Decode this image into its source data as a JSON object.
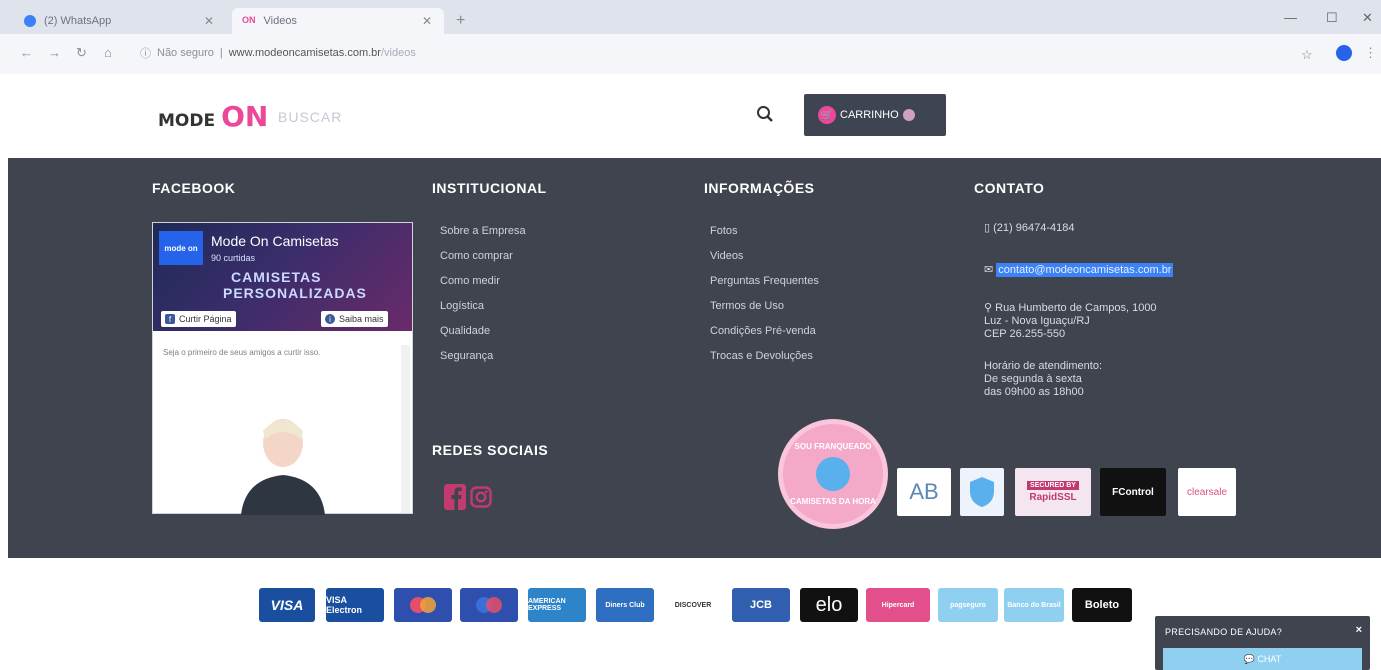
{
  "browser": {
    "tabs": [
      {
        "title": "(2) WhatsApp",
        "favicon_icon": "whatsapp-icon"
      },
      {
        "title": "Videos",
        "favicon_text": "ON",
        "favicon_icon": "modeon-icon"
      }
    ],
    "new_tab": "+",
    "address": {
      "security": "Não seguro",
      "domain": "www.modeoncamisetas.com.br",
      "path": "/videos"
    }
  },
  "header": {
    "logo_mode": "MODE",
    "logo_on": "ON",
    "search_placeholder": "BUSCAR",
    "cart_label": "CARRINHO"
  },
  "footer": {
    "facebook": {
      "title": "FACEBOOK",
      "page_name": "Mode On Camisetas",
      "likes": "90 curtidas",
      "thumb_text": "mode on",
      "slogan_line1": "CAMISETAS",
      "slogan_line2": "PERSONALIZADAS",
      "like_button": "Curtir Página",
      "info_button": "Saiba mais",
      "first_friend": "Seja o primeiro de seus amigos a curtir isso."
    },
    "institucional": {
      "title": "INSTITUCIONAL",
      "links": [
        "Sobre a Empresa",
        "Como comprar",
        "Como medir",
        "Logística",
        "Qualidade",
        "Segurança"
      ]
    },
    "informacoes": {
      "title": "INFORMAÇÕES",
      "links": [
        "Fotos",
        "Videos",
        "Perguntas Frequentes",
        "Termos de Uso",
        "Condições Pré-venda",
        "Trocas e Devoluções"
      ]
    },
    "contato": {
      "title": "CONTATO",
      "phone": "(21) 96474-4184",
      "email": "contato@modeoncamisetas.com.br",
      "address_line1": "Rua Humberto de Campos, 1000",
      "address_line2": "Luz - Nova Iguaçu/RJ",
      "address_line3": "CEP 26.255-550",
      "hours_line1": "Horário de atendimento:",
      "hours_line2": "De segunda à sexta",
      "hours_line3": "das 09h00 as 18h00"
    },
    "redes_sociais": {
      "title": "REDES SOCIAIS"
    },
    "seals": {
      "badge_top": "SOU FRANQUEADO",
      "badge_bottom": "CAMISETAS DA HORA",
      "ab": "AB",
      "rapidssl_top": "SECURED BY",
      "rapidssl": "RapidSSL",
      "fcontrol": "FControl",
      "clearsale": "clearsale"
    }
  },
  "payments": [
    {
      "label": "VISA",
      "color": "#1a4fa0"
    },
    {
      "label": "VISA Electron",
      "color": "#1a4fa0"
    },
    {
      "label": "MasterCard",
      "color": "#2f4fae"
    },
    {
      "label": "Maestro",
      "color": "#2f4fae"
    },
    {
      "label": "AMERICAN EXPRESS",
      "color": "#2e84c8"
    },
    {
      "label": "Diners Club",
      "color": "#2f6fc2"
    },
    {
      "label": "DISCOVER",
      "color": "#ffffff"
    },
    {
      "label": "JCB",
      "color": "#2f5fae"
    },
    {
      "label": "elo",
      "color": "#111111"
    },
    {
      "label": "Hipercard",
      "color": "#e34f8a"
    },
    {
      "label": "pagseguro",
      "color": "#8fd0f0"
    },
    {
      "label": "Banco do Brasil",
      "color": "#8fd0f0"
    },
    {
      "label": "Boleto",
      "color": "#111111"
    }
  ],
  "help": {
    "title": "PRECISANDO DE AJUDA?",
    "close": "×",
    "chat": "CHAT"
  }
}
